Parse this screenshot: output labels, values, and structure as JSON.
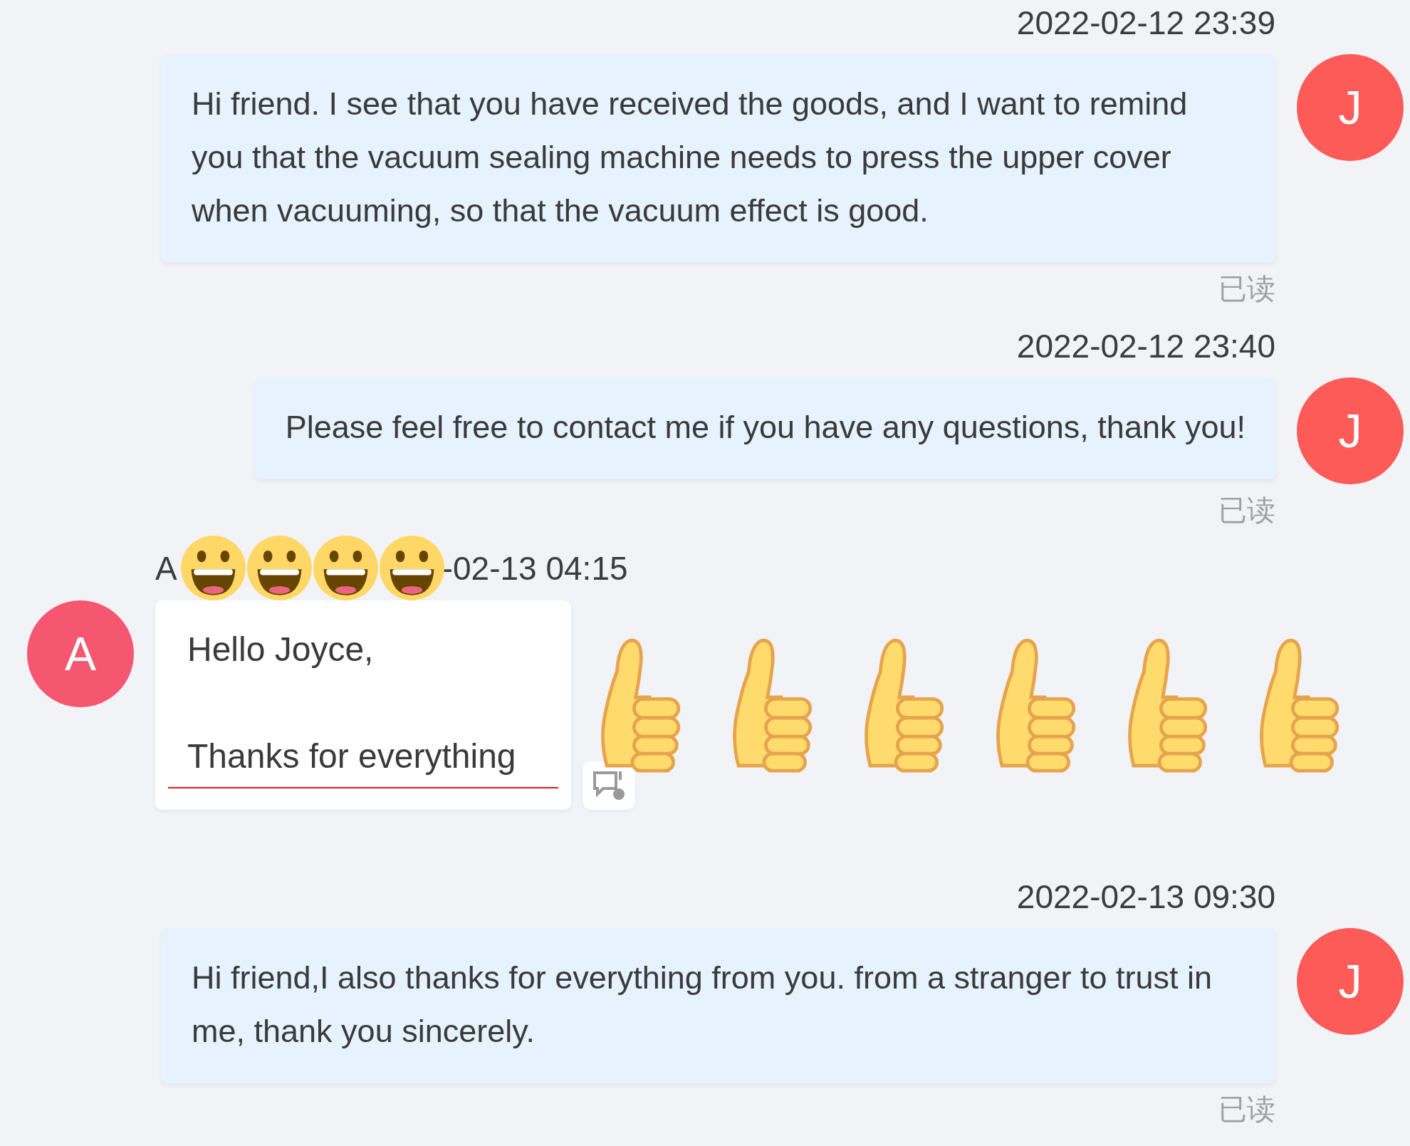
{
  "messages": [
    {
      "kind": "outgoing",
      "time": "2022-02-12 23:39",
      "avatar": {
        "letter": "J",
        "color": "#fc5b58"
      },
      "text": "Hi friend. I see that you have received the goods, and I want to remind you that the vacuum sealing machine needs to press the upper cover when vacuuming, so that the vacuum effect is good.",
      "status": "已读"
    },
    {
      "kind": "outgoing",
      "time": "2022-02-12 23:40",
      "avatar": {
        "letter": "J",
        "color": "#fc5b58"
      },
      "text": "Please feel free to contact me if you have any questions, thank you!",
      "status": "已读"
    },
    {
      "kind": "incoming",
      "sender": "A",
      "time": "-02-13 04:15",
      "avatar": {
        "letter": "A",
        "color": "#f65770"
      },
      "lines": [
        "Hello Joyce,",
        "Thanks for everything"
      ]
    },
    {
      "kind": "outgoing",
      "time": "2022-02-13 09:30",
      "avatar": {
        "letter": "J",
        "color": "#fc5b58"
      },
      "text": "Hi friend,I also thanks for everything from you. from a stranger to trust in me, thank you sincerely.",
      "status": "已读"
    }
  ],
  "overlay": {
    "stickers": [
      {
        "kind": "grin"
      },
      {
        "kind": "grin"
      },
      {
        "kind": "grin"
      },
      {
        "kind": "grin"
      },
      {
        "kind": "thumbs-up"
      },
      {
        "kind": "thumbs-up"
      },
      {
        "kind": "thumbs-up"
      },
      {
        "kind": "thumbs-up"
      },
      {
        "kind": "thumbs-up"
      },
      {
        "kind": "thumbs-up"
      }
    ]
  }
}
